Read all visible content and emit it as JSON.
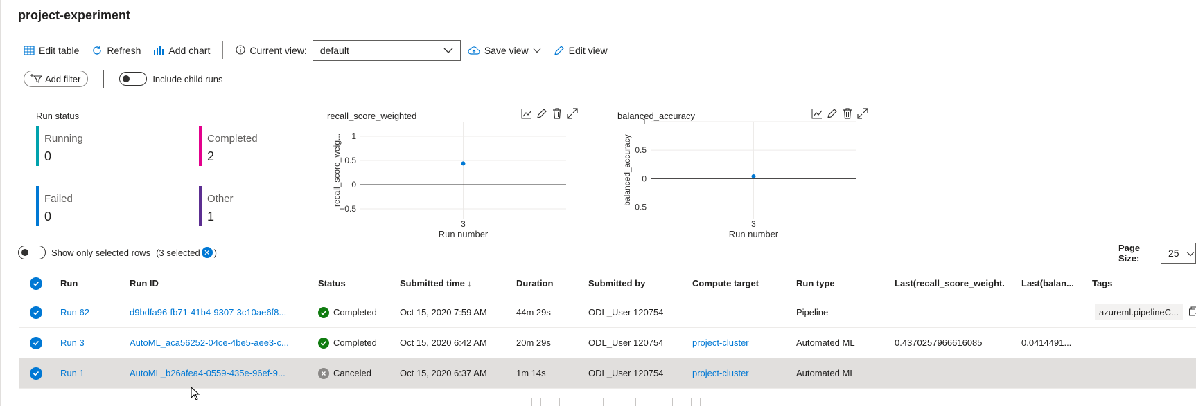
{
  "page": {
    "title": "project-experiment"
  },
  "toolbar": {
    "edit_table": "Edit table",
    "refresh": "Refresh",
    "add_chart": "Add chart",
    "current_view_label": "Current view:",
    "current_view_value": "default",
    "save_view": "Save view",
    "edit_view": "Edit view"
  },
  "filters": {
    "add_filter": "Add filter",
    "include_child_runs": "Include child runs",
    "include_child_runs_on": false
  },
  "run_status": {
    "title": "Run status",
    "items": [
      {
        "label": "Running",
        "count": "0",
        "color": "#00a2ad"
      },
      {
        "label": "Completed",
        "count": "2",
        "color": "#e3008c"
      },
      {
        "label": "Failed",
        "count": "0",
        "color": "#0078d4"
      },
      {
        "label": "Other",
        "count": "1",
        "color": "#5c2e91"
      }
    ]
  },
  "chart_data": [
    {
      "type": "scatter",
      "title": "recall_score_weighted",
      "xlabel": "Run number",
      "ylabel": "recall_score_weig...",
      "x_categories": [
        "3"
      ],
      "ylim": [
        -0.7,
        1.3
      ],
      "yticks": [
        "1",
        "0.5",
        "0",
        "−0.5"
      ],
      "series": [
        {
          "x": "3",
          "y": 0.4370257966616085
        }
      ],
      "color": "#0078d4"
    },
    {
      "type": "scatter",
      "title": "balanced_accuracy",
      "xlabel": "Run number",
      "ylabel": "balanced_accuracy",
      "x_categories": [
        "3"
      ],
      "ylim": [
        -0.7,
        1.0
      ],
      "yticks": [
        "1",
        "0.5",
        "0",
        "−0.5"
      ],
      "series": [
        {
          "x": "3",
          "y": 0.0414491
        }
      ],
      "color": "#0078d4"
    }
  ],
  "selection": {
    "show_only_selected_label": "Show only selected rows",
    "selected_count_text": "(3 selected",
    "selected_count_close": ")"
  },
  "pagination": {
    "page_size_label": "Page Size:",
    "page_size_value": "25"
  },
  "table": {
    "columns": [
      "Run",
      "Run ID",
      "Status",
      "Submitted time ↓",
      "Duration",
      "Submitted by",
      "Compute target",
      "Run type",
      "Last(recall_score_weight...",
      "Last(balan...",
      "Tags"
    ],
    "rows": [
      {
        "run": "Run 62",
        "run_id": "d9bdfa96-fb71-41b4-9307-3c10ae6f8...",
        "status": "Completed",
        "submitted": "Oct 15, 2020 7:59 AM",
        "duration": "44m 29s",
        "by": "ODL_User 120754",
        "compute": "",
        "type": "Pipeline",
        "recall": "",
        "balanced": "",
        "tags": "azureml.pipelineC..."
      },
      {
        "run": "Run 3",
        "run_id": "AutoML_aca56252-04ce-4be5-aee3-c...",
        "status": "Completed",
        "submitted": "Oct 15, 2020 6:42 AM",
        "duration": "20m 29s",
        "by": "ODL_User 120754",
        "compute": "project-cluster",
        "type": "Automated ML",
        "recall": "0.4370257966616085",
        "balanced": "0.0414491...",
        "tags": ""
      },
      {
        "run": "Run 1",
        "run_id": "AutoML_b26afea4-0559-435e-96ef-9...",
        "status": "Canceled",
        "submitted": "Oct 15, 2020 6:37 AM",
        "duration": "1m 14s",
        "by": "ODL_User 120754",
        "compute": "project-cluster",
        "type": "Automated ML",
        "recall": "",
        "balanced": "",
        "tags": ""
      }
    ]
  }
}
